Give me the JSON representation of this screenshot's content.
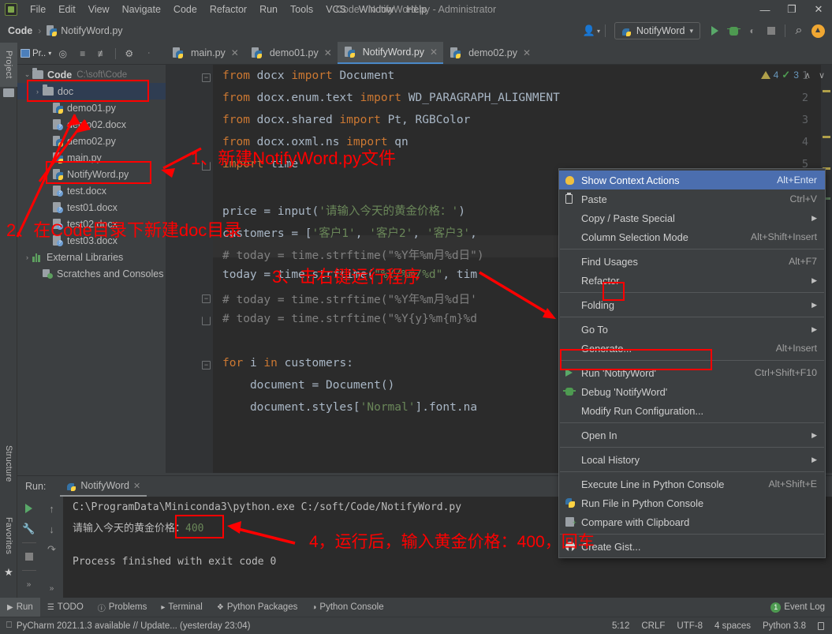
{
  "window": {
    "title": "Code - NotifyWord.py - Administrator",
    "minimize": "—",
    "maximize": "❐",
    "close": "✕"
  },
  "menubar": {
    "items": [
      "File",
      "Edit",
      "View",
      "Navigate",
      "Code",
      "Refactor",
      "Run",
      "Tools",
      "VCS",
      "Window",
      "Help"
    ]
  },
  "breadcrumb": {
    "root": "Code",
    "separator": "›",
    "file": "NotifyWord.py"
  },
  "navbar_right": {
    "run_config": "NotifyWord",
    "dropdown_caret": "▾",
    "search_icon": "⌕"
  },
  "left_strip": {
    "project": "Project",
    "structure": "Structure",
    "favorites": "Favorites"
  },
  "project_panel": {
    "chip_label": "Pr..",
    "tree": [
      {
        "indent": 0,
        "twisty": "⌄",
        "icon": "folder",
        "label": "Code",
        "path": "C:\\soft\\Code",
        "bold": true,
        "selected": false
      },
      {
        "indent": 1,
        "twisty": "›",
        "icon": "folder",
        "label": "doc",
        "path": "",
        "bold": false,
        "selected": true
      },
      {
        "indent": 2,
        "twisty": "",
        "icon": "py",
        "label": "demo01.py",
        "path": "",
        "bold": false,
        "selected": false
      },
      {
        "indent": 2,
        "twisty": "",
        "icon": "docx",
        "label": "demo02.docx",
        "path": "",
        "bold": false,
        "selected": false
      },
      {
        "indent": 2,
        "twisty": "",
        "icon": "py",
        "label": "demo02.py",
        "path": "",
        "bold": false,
        "selected": false
      },
      {
        "indent": 2,
        "twisty": "",
        "icon": "py",
        "label": "main.py",
        "path": "",
        "bold": false,
        "selected": false
      },
      {
        "indent": 2,
        "twisty": "",
        "icon": "py",
        "label": "NotifyWord.py",
        "path": "",
        "bold": false,
        "selected": false
      },
      {
        "indent": 2,
        "twisty": "",
        "icon": "docx",
        "label": "test.docx",
        "path": "",
        "bold": false,
        "selected": false
      },
      {
        "indent": 2,
        "twisty": "",
        "icon": "docx",
        "label": "test01.docx",
        "path": "",
        "bold": false,
        "selected": false
      },
      {
        "indent": 2,
        "twisty": "",
        "icon": "docx",
        "label": "test02.docx",
        "path": "",
        "bold": false,
        "selected": false
      },
      {
        "indent": 2,
        "twisty": "",
        "icon": "docx",
        "label": "test03.docx",
        "path": "",
        "bold": false,
        "selected": false
      },
      {
        "indent": 0,
        "twisty": "›",
        "icon": "lib",
        "label": "External Libraries",
        "path": "",
        "bold": false,
        "selected": false
      },
      {
        "indent": 1,
        "twisty": "",
        "icon": "scratch",
        "label": "Scratches and Consoles",
        "path": "",
        "bold": false,
        "selected": false
      }
    ]
  },
  "editor_tabs": [
    {
      "label": "main.py",
      "active": false
    },
    {
      "label": "demo01.py",
      "active": false
    },
    {
      "label": "NotifyWord.py",
      "active": true
    },
    {
      "label": "demo02.py",
      "active": false
    }
  ],
  "editor_inspection": {
    "warning_count": "4",
    "ok_count": "3",
    "up": "∧",
    "down": "∨"
  },
  "code": {
    "lines": [
      {
        "n": "1",
        "fold": "minus",
        "text": "from docx import Document"
      },
      {
        "n": "2",
        "fold": "",
        "text": "from docx.enum.text import WD_PARAGRAPH_ALIGNMENT"
      },
      {
        "n": "3",
        "fold": "",
        "text": "from docx.shared import Pt, RGBColor"
      },
      {
        "n": "4",
        "fold": "",
        "text": "from docx.oxml.ns import qn"
      },
      {
        "n": "5",
        "fold": "end",
        "text": "import time"
      },
      {
        "n": "6",
        "fold": "",
        "text": ""
      },
      {
        "n": "7",
        "fold": "",
        "text": "price = input('请输入今天的黄金价格：')"
      },
      {
        "n": "8",
        "fold": "",
        "text": "customers = ['客户1', '客户2', '客户3',"
      },
      {
        "n": "9",
        "fold": "",
        "text": "# today = time.strftime(\"%Y年%m月%d日\")"
      },
      {
        "n": "10",
        "fold": "",
        "text": "today = time.strftime(\"%Y/%m/%d\", tim"
      },
      {
        "n": "11",
        "fold": "minus",
        "text": "# today = time.strftime(\"%Y年%m月%d日'"
      },
      {
        "n": "12",
        "fold": "end",
        "text": "# today = time.strftime(\"%Y{y}%m{m}%d"
      },
      {
        "n": "13",
        "fold": "",
        "text": ""
      },
      {
        "n": "14",
        "fold": "minus",
        "text": "for i in customers:"
      },
      {
        "n": "15",
        "fold": "",
        "text": "    document = Document()"
      },
      {
        "n": "16",
        "fold": "",
        "text": "    document.styles['Normal'].font.na"
      }
    ]
  },
  "context_menu": {
    "items": [
      {
        "icon": "bulb",
        "label": "Show Context Actions",
        "shortcut": "Alt+Enter",
        "arrow": false,
        "selected": true,
        "sep_after": false
      },
      {
        "icon": "clip",
        "label": "Paste",
        "shortcut": "Ctrl+V",
        "arrow": false,
        "selected": false,
        "sep_after": false
      },
      {
        "icon": "",
        "label": "Copy / Paste Special",
        "shortcut": "",
        "arrow": true,
        "selected": false,
        "sep_after": false
      },
      {
        "icon": "",
        "label": "Column Selection Mode",
        "shortcut": "Alt+Shift+Insert",
        "arrow": false,
        "selected": false,
        "sep_after": true
      },
      {
        "icon": "",
        "label": "Find Usages",
        "shortcut": "Alt+F7",
        "arrow": false,
        "selected": false,
        "sep_after": false
      },
      {
        "icon": "",
        "label": "Refactor",
        "shortcut": "",
        "arrow": true,
        "selected": false,
        "sep_after": true
      },
      {
        "icon": "",
        "label": "Folding",
        "shortcut": "",
        "arrow": true,
        "selected": false,
        "sep_after": true
      },
      {
        "icon": "",
        "label": "Go To",
        "shortcut": "",
        "arrow": true,
        "selected": false,
        "sep_after": false
      },
      {
        "icon": "",
        "label": "Generate...",
        "shortcut": "Alt+Insert",
        "arrow": false,
        "selected": false,
        "sep_after": true
      },
      {
        "icon": "runtri",
        "label": "Run 'NotifyWord'",
        "shortcut": "Ctrl+Shift+F10",
        "arrow": false,
        "selected": false,
        "sep_after": false
      },
      {
        "icon": "debug",
        "label": "Debug 'NotifyWord'",
        "shortcut": "",
        "arrow": false,
        "selected": false,
        "sep_after": false
      },
      {
        "icon": "",
        "label": "Modify Run Configuration...",
        "shortcut": "",
        "arrow": false,
        "selected": false,
        "sep_after": true
      },
      {
        "icon": "",
        "label": "Open In",
        "shortcut": "",
        "arrow": true,
        "selected": false,
        "sep_after": true
      },
      {
        "icon": "",
        "label": "Local History",
        "shortcut": "",
        "arrow": true,
        "selected": false,
        "sep_after": true
      },
      {
        "icon": "",
        "label": "Execute Line in Python Console",
        "shortcut": "Alt+Shift+E",
        "arrow": false,
        "selected": false,
        "sep_after": false
      },
      {
        "icon": "python",
        "label": "Run File in Python Console",
        "shortcut": "",
        "arrow": false,
        "selected": false,
        "sep_after": false
      },
      {
        "icon": "compare",
        "label": "Compare with Clipboard",
        "shortcut": "",
        "arrow": false,
        "selected": false,
        "sep_after": true
      },
      {
        "icon": "github",
        "label": "Create Gist...",
        "shortcut": "",
        "arrow": false,
        "selected": false,
        "sep_after": false
      }
    ]
  },
  "run_panel": {
    "label": "Run:",
    "tab": "NotifyWord",
    "close": "✕",
    "console": {
      "command": "C:\\ProgramData\\Miniconda3\\python.exe C:/soft/Code/NotifyWord.py",
      "prompt": "请输入今天的黄金价格：",
      "input_value": "400",
      "result": "Process finished with exit code 0"
    },
    "tool_icons": [
      "run-icon",
      "wrench-icon",
      "stop-icon",
      "expand-icon",
      "scroll-up-icon",
      "scroll-down-icon",
      "soft-wrap-icon",
      "more-icon"
    ]
  },
  "toolwindow_bar": {
    "items": [
      {
        "label": "Run",
        "icon": "run-icon",
        "selected": true
      },
      {
        "label": "TODO",
        "icon": "todo-icon",
        "selected": false
      },
      {
        "label": "Problems",
        "icon": "problems-icon",
        "selected": false
      },
      {
        "label": "Terminal",
        "icon": "terminal-icon",
        "selected": false
      },
      {
        "label": "Python Packages",
        "icon": "packages-icon",
        "selected": false
      },
      {
        "label": "Python Console",
        "icon": "python-icon",
        "selected": false
      }
    ],
    "event_log": "Event Log",
    "event_count": "1"
  },
  "statusbar": {
    "message": "PyCharm 2021.1.3 available // Update... (yesterday 23:04)",
    "caret": "5:12",
    "line_sep": "CRLF",
    "encoding": "UTF-8",
    "indent": "4 spaces",
    "interpreter": "Python 3.8"
  },
  "annotations": {
    "step1": "1、新建NotifyWord.py文件",
    "step2": "2、在Code目录下新建doc目录",
    "step3": "3、击右键运行程序",
    "step4": "4，运行后，输入黄金价格：400，回车",
    "color": "#ff0000"
  }
}
